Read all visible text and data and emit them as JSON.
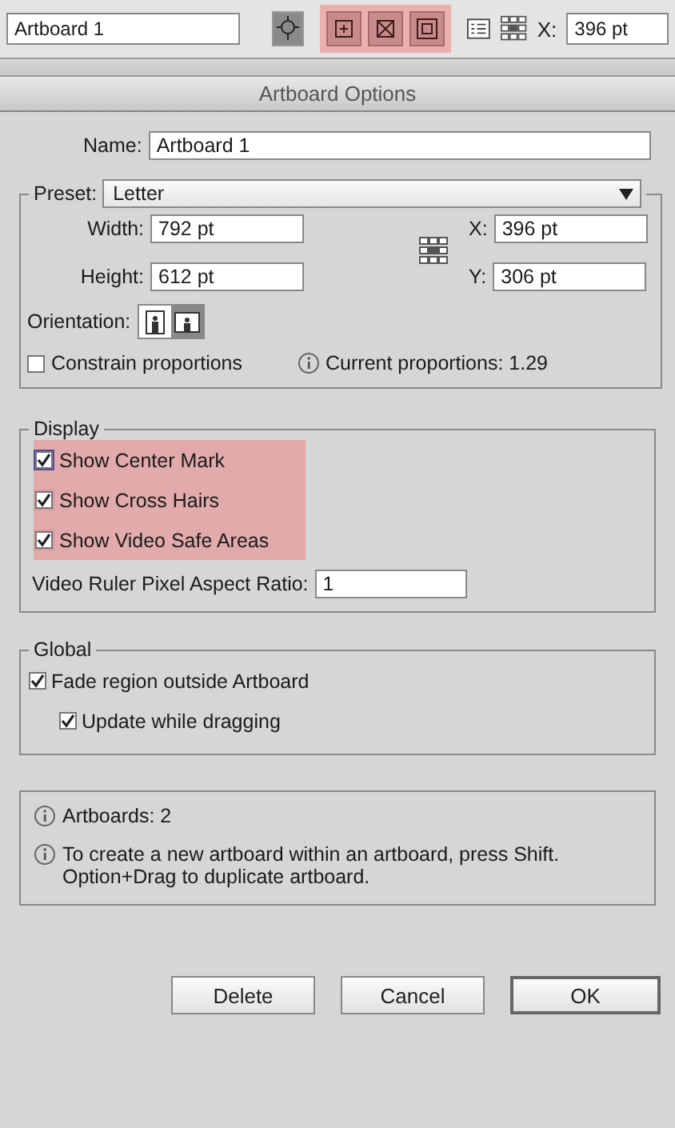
{
  "toolbar": {
    "artboard_name": "Artboard 1",
    "move_button": {
      "selected": true
    },
    "mark_buttons": [
      {
        "kind": "center",
        "highlighted": true
      },
      {
        "kind": "cross",
        "highlighted": true
      },
      {
        "kind": "safe",
        "highlighted": true
      }
    ],
    "x_label": "X:",
    "x_value": "396 pt"
  },
  "window": {
    "title": "Artboard Options"
  },
  "name": {
    "label": "Name:",
    "value": "Artboard 1"
  },
  "preset": {
    "label": "Preset:",
    "value": "Letter"
  },
  "width": {
    "label": "Width:",
    "value": "792 pt"
  },
  "height": {
    "label": "Height:",
    "value": "612 pt"
  },
  "x": {
    "label": "X:",
    "value": "396 pt"
  },
  "y": {
    "label": "Y:",
    "value": "306 pt"
  },
  "orientation": {
    "label": "Orientation:",
    "options": [
      {
        "kind": "portrait",
        "selected": false
      },
      {
        "kind": "landscape",
        "selected": true
      }
    ]
  },
  "constrain": {
    "label": "Constrain proportions",
    "checked": false
  },
  "proportions": "Current proportions: 1.29",
  "display": {
    "title": "Display",
    "checkboxes": [
      {
        "label": "Show Center Mark",
        "checked": true,
        "highlighted": true,
        "focused": true
      },
      {
        "label": "Show Cross Hairs",
        "checked": true,
        "highlighted": true,
        "focused": false
      },
      {
        "label": "Show Video Safe Areas",
        "checked": true,
        "highlighted": true,
        "focused": false
      }
    ],
    "ratio_label": "Video Ruler Pixel Aspect Ratio:",
    "ratio_value": "1"
  },
  "global": {
    "title": "Global",
    "checkboxes": [
      {
        "label": "Fade region outside Artboard",
        "checked": true,
        "children": [
          {
            "label": "Update while dragging",
            "checked": true
          }
        ]
      }
    ]
  },
  "info": [
    "Artboards: 2",
    "To create a new artboard within an artboard, press Shift. Option+Drag to duplicate artboard."
  ],
  "buttons": [
    {
      "label": "Delete",
      "default": false
    },
    {
      "label": "Cancel",
      "default": false
    },
    {
      "label": "OK",
      "default": true
    }
  ]
}
